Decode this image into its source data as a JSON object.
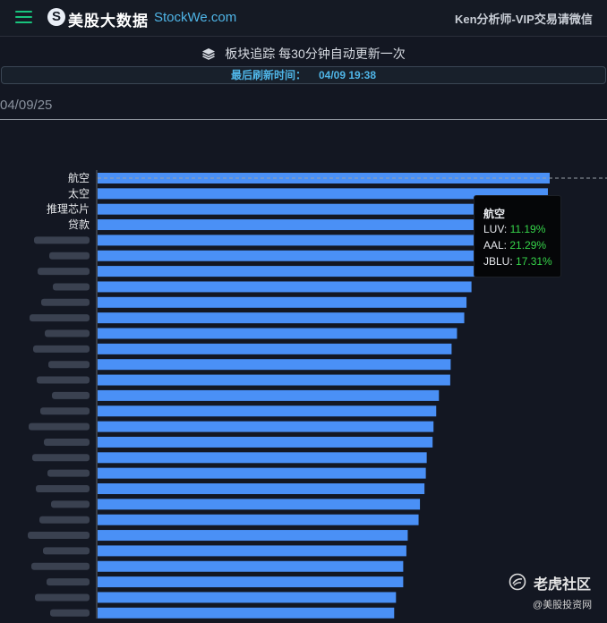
{
  "header": {
    "brand_cn": "美股大数据",
    "brand_en": "StockWe.com",
    "right_text": "Ken分析师-VIP交易请微信"
  },
  "notice": {
    "text": "板块追踪 每30分钟自动更新一次",
    "refresh_label": "最后刷新时间：",
    "refresh_value": "04/09 19:38"
  },
  "date_label": "04/09/25",
  "tooltip": {
    "title": "航空",
    "rows": [
      {
        "label": "LUV:",
        "value": "11.19%"
      },
      {
        "label": "AAL:",
        "value": "21.29%"
      },
      {
        "label": "JBLU:",
        "value": "17.31%"
      }
    ]
  },
  "watermark": {
    "name": "老虎社区",
    "sub": "@美股投资网"
  },
  "colors": {
    "bar": "#4a90f6",
    "background": "#131722",
    "positive": "#36d54a",
    "accent": "#4fb5e7"
  },
  "chart_data": {
    "type": "bar",
    "orientation": "horizontal",
    "categories": [
      "航空",
      "太空",
      "推理芯片",
      "贷款",
      "",
      "",
      "",
      "",
      "",
      "",
      "",
      "",
      "",
      "",
      "",
      "",
      "",
      "",
      "",
      "",
      "",
      "",
      "",
      "",
      "",
      "",
      "",
      "",
      "",
      ""
    ],
    "values": [
      100,
      99.6,
      95.2,
      95.0,
      93.5,
      92.5,
      90.3,
      82.7,
      81.6,
      81.1,
      79.5,
      78.3,
      78.1,
      78.0,
      75.5,
      74.9,
      74.3,
      74.1,
      72.8,
      72.6,
      72.3,
      71.3,
      71.0,
      68.6,
      68.3,
      67.6,
      67.6,
      66.0,
      65.6,
      65.6
    ],
    "value_note": "bar lengths relative to the longest bar (=100); no value axis is shown",
    "grid": false,
    "legend": "none"
  }
}
